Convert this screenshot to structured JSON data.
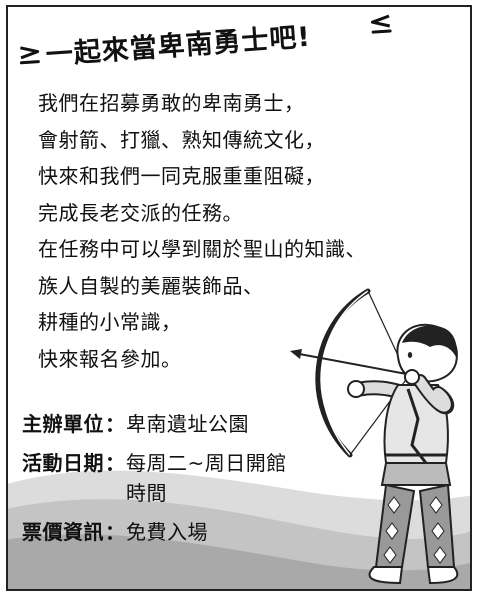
{
  "poster": {
    "title": "一起來當卑南勇士吧!",
    "body_lines": [
      "我們在招募勇敢的卑南勇士，",
      "會射箭、打獵、熟知傳統文化，",
      "快來和我們一同克服重重阻礙，",
      "完成長老交派的任務。",
      "在任務中可以學到關於聖山的知識、",
      "族人自製的美麗裝飾品、",
      "耕種的小常識，",
      "快來報名參加。"
    ],
    "info": [
      {
        "label": "主辦單位",
        "colon": "：",
        "value": "卑南遺址公園"
      },
      {
        "label": "活動日期",
        "colon": "：",
        "value": "每周二~周日開館時間"
      },
      {
        "label": "票價資訊",
        "colon": "：",
        "value": "免費入場"
      }
    ]
  },
  "colors": {
    "hill_light": "#dcdcdc",
    "hill_dark": "#a9a9a9",
    "outline": "#222222"
  }
}
